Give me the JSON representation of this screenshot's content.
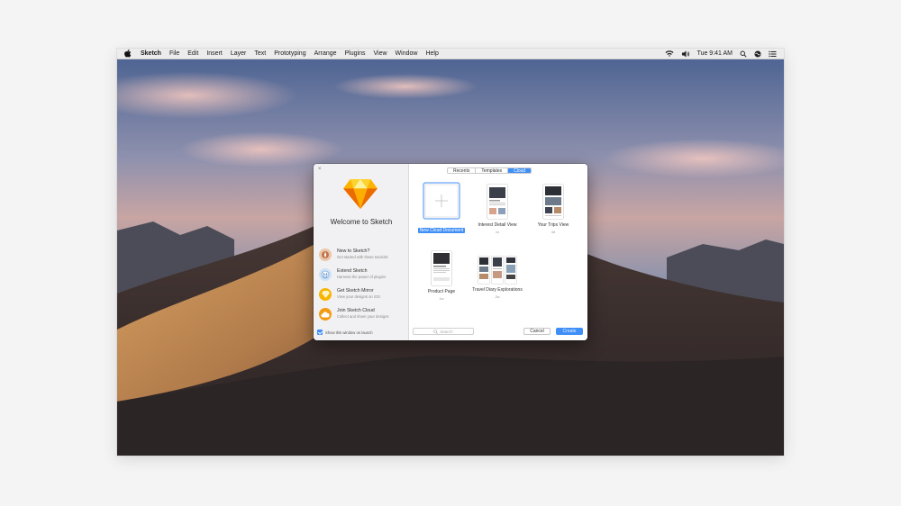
{
  "menubar": {
    "app_name": "Sketch",
    "menus": [
      "File",
      "Edit",
      "Insert",
      "Layer",
      "Text",
      "Prototyping",
      "Arrange",
      "Plugins",
      "View",
      "Window",
      "Help"
    ],
    "clock": "Tue 9:41 AM",
    "status_icons": [
      "wifi-icon",
      "volume-icon",
      "search-icon",
      "siri-icon",
      "list-icon"
    ]
  },
  "dialog": {
    "close_glyph": "×",
    "welcome_title": "Welcome to Sketch",
    "left_items": [
      {
        "title": "New to Sketch?",
        "subtitle": "Get started with these tutorials",
        "icon": "compass-icon"
      },
      {
        "title": "Extend Sketch",
        "subtitle": "Harness the power of plugins",
        "icon": "plug-icon"
      },
      {
        "title": "Get Sketch Mirror",
        "subtitle": "View your designs on iOS",
        "icon": "diamond-icon"
      },
      {
        "title": "Join Sketch Cloud",
        "subtitle": "Collect and share your designs",
        "icon": "cloud-icon"
      }
    ],
    "show_on_launch": {
      "label": "Show this window on launch",
      "checked": true
    },
    "tabs": [
      "Recents",
      "Templates",
      "Cloud"
    ],
    "active_tab": "Cloud",
    "documents": [
      {
        "name": "New Cloud Document",
        "sub": "",
        "selected": true
      },
      {
        "name": "Interest Detail View",
        "sub": "1x",
        "selected": false
      },
      {
        "name": "Your Trips View",
        "sub": "4d",
        "selected": false
      },
      {
        "name": "Product Page",
        "sub": "1w",
        "selected": false
      },
      {
        "name": "Travel Diary Explorations",
        "sub": "2w",
        "selected": false
      }
    ],
    "search_placeholder": "Search",
    "cancel_label": "Cancel",
    "open_label": "Create"
  },
  "colors": {
    "accent": "#3f8ff7",
    "sketch_yellow": "#f7b500"
  }
}
